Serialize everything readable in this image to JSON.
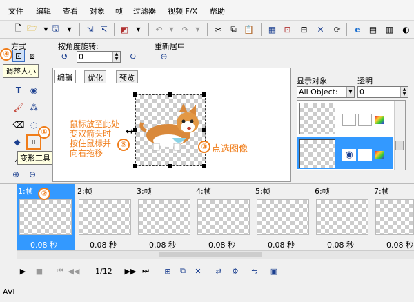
{
  "menu": [
    "文件",
    "编辑",
    "查看",
    "对象",
    "帧",
    "过滤器",
    "视频 F/X",
    "帮助"
  ],
  "options": {
    "method_label": "方式",
    "rotate_label": "按角度旋转:",
    "rotate_value": "0",
    "recenter_label": "重新居中"
  },
  "tooltips": {
    "resize": "调整大小",
    "transform": "变形工具"
  },
  "editor_tabs": [
    "编辑",
    "优化",
    "预览"
  ],
  "annotations": {
    "n1": "①",
    "n2": "②",
    "n3": "③",
    "n4": "④",
    "n5": "⑤",
    "hint_lines": [
      "鼠标放至此处",
      "变双箭头时",
      "按住鼠标并",
      "向右拖移"
    ],
    "select_image": "点选图像"
  },
  "right_panel": {
    "display_label": "显示对象",
    "opacity_label": "透明",
    "display_value": "All Object:",
    "opacity_value": "0"
  },
  "frames": [
    {
      "label": "1:帧",
      "delay": "0.08 秒",
      "selected": true
    },
    {
      "label": "2:帧",
      "delay": "0.08 秒",
      "selected": false
    },
    {
      "label": "3:帧",
      "delay": "0.08 秒",
      "selected": false
    },
    {
      "label": "4:帧",
      "delay": "0.08 秒",
      "selected": false
    },
    {
      "label": "5:帧",
      "delay": "0.08 秒",
      "selected": false
    },
    {
      "label": "6:帧",
      "delay": "0.08 秒",
      "selected": false
    },
    {
      "label": "7:帧",
      "delay": "0.08 秒",
      "selected": false
    }
  ],
  "player": {
    "counter": "1/12"
  },
  "status": {
    "text": "AVI"
  },
  "colors": {
    "accent": "#f07d1a",
    "selection": "#3399ff"
  }
}
